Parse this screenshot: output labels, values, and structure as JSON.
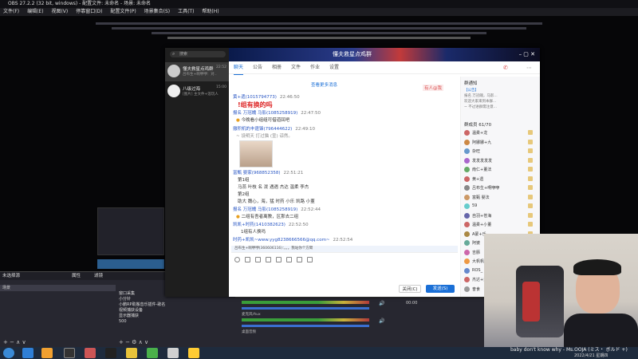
{
  "obs": {
    "title": "OBS 27.2.2 (32 bit, windows) - 配置文件: 未命名 - 场景: 未命名",
    "menu": [
      "文件(F)",
      "编辑(E)",
      "视图(V)",
      "停靠窗口(D)",
      "配置文件(P)",
      "场景集合(S)",
      "工具(T)",
      "帮助(H)"
    ],
    "scenes_header": "未选择源",
    "scene_item": "场景",
    "filters_label": "滤镜",
    "properties_label": "属性",
    "sources_header": "源",
    "sources": [
      "窗口采集",
      "小分针",
      "小鹏RP助搬音乐插件-歌名",
      "视频捕获设备",
      "显示器捕获",
      "500"
    ],
    "audio_label_1": "麦克风/Aux",
    "audio_label_2": "桌面音频",
    "mixer_time": "00:00",
    "colors": {
      "accent": "#1a6fd6",
      "red": "#d22222",
      "obs_bg": "#1b1b1f"
    }
  },
  "qq": {
    "search_placeholder": "搜索",
    "window_title": "懂夫救星点鸡群",
    "conversations": [
      {
        "name": "懂夫救星点鸡群",
        "time": "22:52",
        "preview": "吕布生+啊咿咿：对.."
      },
      {
        "name": "八级过海",
        "time": "15:00",
        "preview": "[图片] 主文件+莲玩人"
      }
    ],
    "tabs": [
      "聊天",
      "公告",
      "相册",
      "文件",
      "作业",
      "设置"
    ],
    "view_more": "查看更多消息",
    "new_member_badge": "有人@我",
    "messages": [
      {
        "nick": "黄+遗(1015794773)",
        "time": "22:46:50",
        "text": "!组有换的吗",
        "style": "red"
      },
      {
        "nick": "报名 万冠魄 马影(1085258919)",
        "time": "22:47:50",
        "text": "今晚看小组组可借道回吧"
      },
      {
        "nick": "撤积机的丰霆锋(796444622)",
        "time": "22:49:10",
        "text": "~ 设明天 打过猫 (宣)   谅然。"
      },
      {
        "nick": "富甄 婴家(968852358)",
        "time": "22:51:21",
        "text": "第1组"
      },
      {
        "text": "马蕊  叶枝 名  泼  遇遇  杰达  温柔  李杰"
      },
      {
        "text": "第2组"
      },
      {
        "text": "助大  魏心，海，猛  时药  小乐  凯路  小董"
      },
      {
        "nick": "报名 万冠魄 马影(1085258919)",
        "time": "22:52:44",
        "text": "二组有吾者离教，区那去二组"
      },
      {
        "nick": "凯凯+时药(1410382623)",
        "time": "22:52:50",
        "text": "1组有人换吗"
      },
      {
        "nick": "时药+凯凯~www.yyg8238666566@qq.com~",
        "time": "22:52:54",
        "text": ""
      }
    ],
    "reply_bar": "吕布生+啊咿咿(360606116)：。。。我站你个方臂",
    "close_button": "关闭(C)",
    "send_button": "发送(S)",
    "right_panel": {
      "notice_title": "群通知",
      "notice_lines": [
        "【公告】",
        "报名 万冠魄，马影...",
        "欢迎大家来到本群...",
        "~ 不过进群需注意..."
      ],
      "members_title": "群成员 61/70",
      "members": [
        "温柔+龙",
        "阿娜娜+九",
        "杂旺",
        "发发发发发",
        "南仁+董法",
        "黄+遗",
        "吕布生+啊咿咿",
        "富甄 婴法",
        "59",
        "自羽+苍海",
        "温柔+小董",
        "A蒙+乐",
        "阿婆",
        "吉豚",
        "大帆帆",
        "ROS_",
        "杰达+洋",
        "奋食"
      ]
    }
  },
  "stream": {
    "song_ticker": "baby don't know why - Ms.OOJA (ミス・ ボルド +)",
    "timestamp": "2022/4/21 星期四"
  }
}
